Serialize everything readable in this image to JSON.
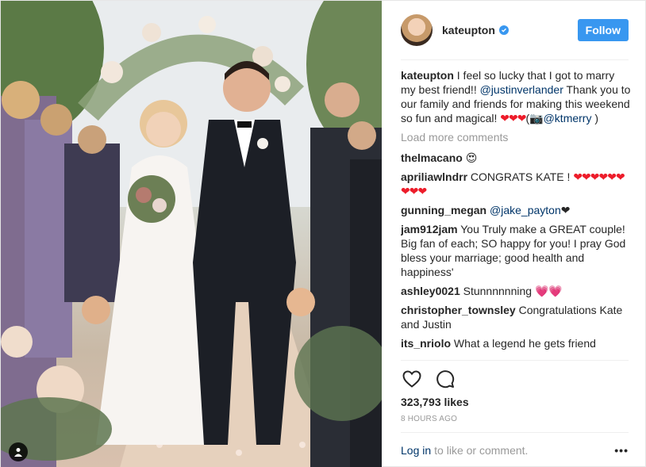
{
  "header": {
    "username": "kateupton",
    "follow_label": "Follow"
  },
  "caption": {
    "user": "kateupton",
    "text1": "I feel so lucky that I got to marry my best friend!! ",
    "mention1": "@justinverlander",
    "text2": " Thank you to our family and friends for making this weekend so fun and magical! ",
    "hearts": "❤❤❤",
    "text3": "(📷",
    "mention2": "@ktmerry",
    "text4": " )"
  },
  "load_more_label": "Load more comments",
  "comments": [
    {
      "user": "thelmacano",
      "text": "",
      "emoji": "😍"
    },
    {
      "user": "apriliawlndrr",
      "text": "CONGRATS KATE ! ",
      "hearts": "❤❤❤❤❤❤❤❤❤"
    },
    {
      "user": "gunning_megan",
      "mention": "@jake_payton",
      "suffix": "❤"
    },
    {
      "user": "jam912jam",
      "text": "You Truly make a GREAT couple! Big fan of each; SO happy for you! I pray God bless your marriage; good health and happiness'"
    },
    {
      "user": "ashley0021",
      "text": "Stunnnnnning ",
      "hearts": "💗💗"
    },
    {
      "user": "christopher_townsley",
      "text": "Congratulations Kate and Justin"
    },
    {
      "user": "its_nriolo",
      "text": "What a legend he gets friend"
    }
  ],
  "likes_label": "323,793 likes",
  "timestamp": "8 HOURS AGO",
  "footer": {
    "login_label": "Log in",
    "rest_label": "to like or comment.",
    "more_label": "•••"
  },
  "colors": {
    "accent": "#3897f0",
    "link": "#003569",
    "muted": "#999999",
    "heart": "#ed1c2a"
  },
  "icons": [
    "user-tag-icon",
    "verified-icon",
    "heart-icon",
    "comment-icon",
    "more-options-icon"
  ]
}
